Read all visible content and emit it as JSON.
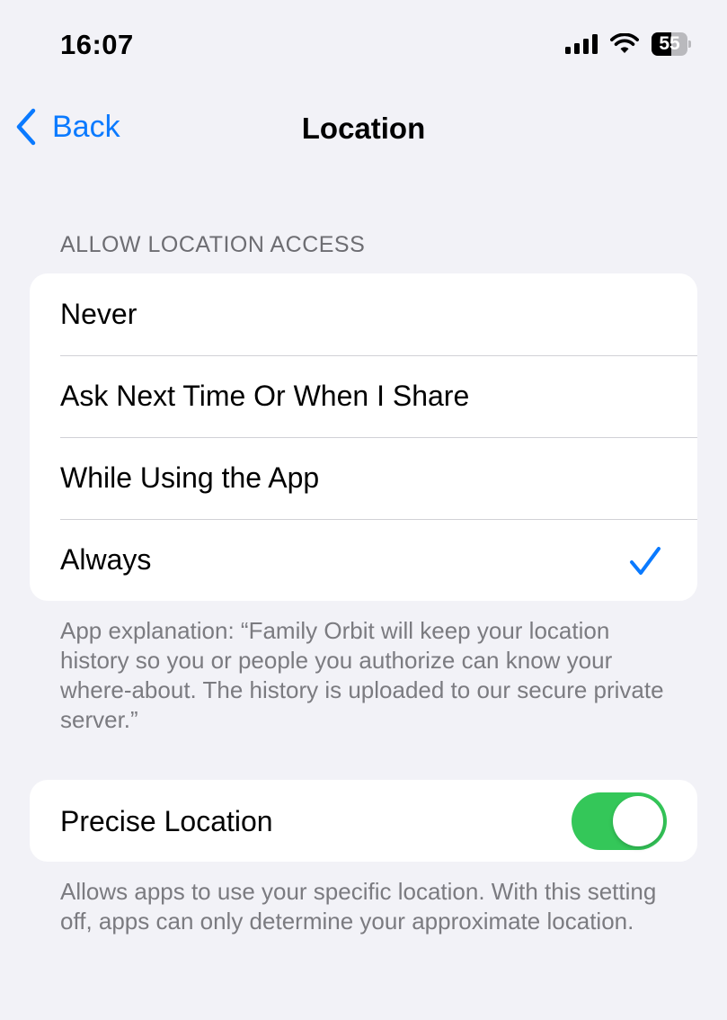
{
  "status_bar": {
    "time": "16:07",
    "battery_level": "55",
    "battery_fraction": 0.55,
    "icons": [
      "cellular-signal-icon",
      "wifi-icon",
      "battery-icon"
    ]
  },
  "nav": {
    "back_label": "Back",
    "title": "Location",
    "back_icon": "chevron-left-icon",
    "accent_color": "#0a7aff"
  },
  "location_access": {
    "header": "ALLOW LOCATION ACCESS",
    "options": [
      {
        "label": "Never",
        "selected": false
      },
      {
        "label": "Ask Next Time Or When I Share",
        "selected": false
      },
      {
        "label": "While Using the App",
        "selected": false
      },
      {
        "label": "Always",
        "selected": true
      }
    ],
    "check_icon": "checkmark-icon",
    "explanation": "App explanation: “Family Orbit will keep your location history so you or people you authorize can know your where-about. The history is uploaded to our secure private server.”"
  },
  "precise_location": {
    "label": "Precise Location",
    "enabled": true,
    "toggle_color": "#34c759",
    "footer": "Allows apps to use your specific location. With this setting off, apps can only determine your approximate location."
  }
}
